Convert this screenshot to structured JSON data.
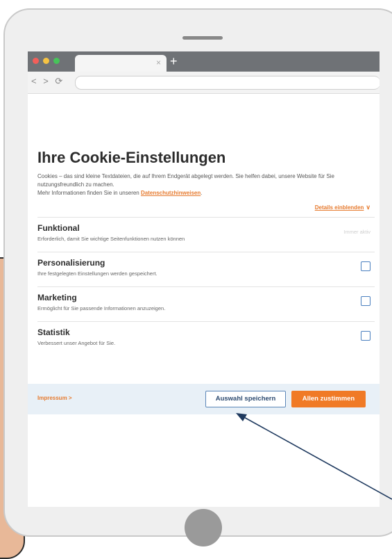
{
  "browser": {
    "tab_close": "×",
    "new_tab": "+",
    "nav_icons": "< > ⟳"
  },
  "cookie": {
    "title": "Ihre Cookie-Einstellungen",
    "description": "Cookies – das sind kleine Textdateien, die auf Ihrem Endgerät abgelegt werden. Sie helfen dabei, unsere Website für Sie nutzungsfreundlich zu machen.",
    "more_info_prefix": "Mehr Informationen finden Sie in unseren ",
    "privacy_link": "Datenschutzhinweisen",
    "more_info_suffix": ".",
    "details_link": "Details einblenden",
    "categories": [
      {
        "name": "Funktional",
        "description": "Erforderlich, damit Sie wichtige Seitenfunktionen nutzen können",
        "status": "Immer aktiv"
      },
      {
        "name": "Personalisierung",
        "description": "Ihre festgelegten Einstellungen werden gespeichert.",
        "checked": false
      },
      {
        "name": "Marketing",
        "description": "Ermöglicht für Sie passende Informationen anzuzeigen.",
        "checked": false
      },
      {
        "name": "Statistik",
        "description": "Verbessert unser Angebot für Sie.",
        "checked": false
      }
    ]
  },
  "footer": {
    "imprint": "Impressum >",
    "save_label": "Auswahl speichern",
    "accept_label": "Allen zustimmen"
  },
  "colors": {
    "accent": "#f07a26",
    "button_border": "#5b86b8",
    "footer_bg": "#e8f0f7"
  }
}
